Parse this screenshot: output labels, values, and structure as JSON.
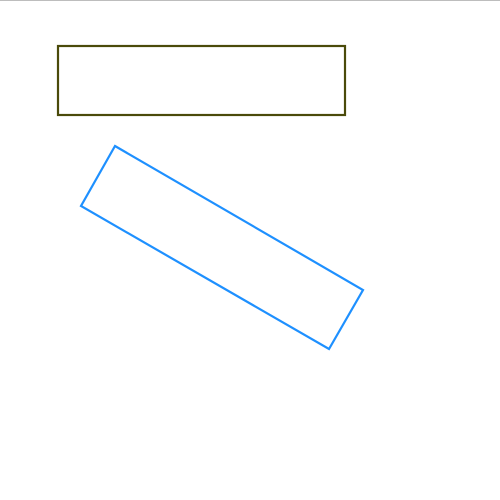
{
  "shapes": {
    "rectangle": {
      "stroke": "#4a4a0a"
    },
    "rotated_rectangle": {
      "stroke": "#1e90ff"
    }
  }
}
